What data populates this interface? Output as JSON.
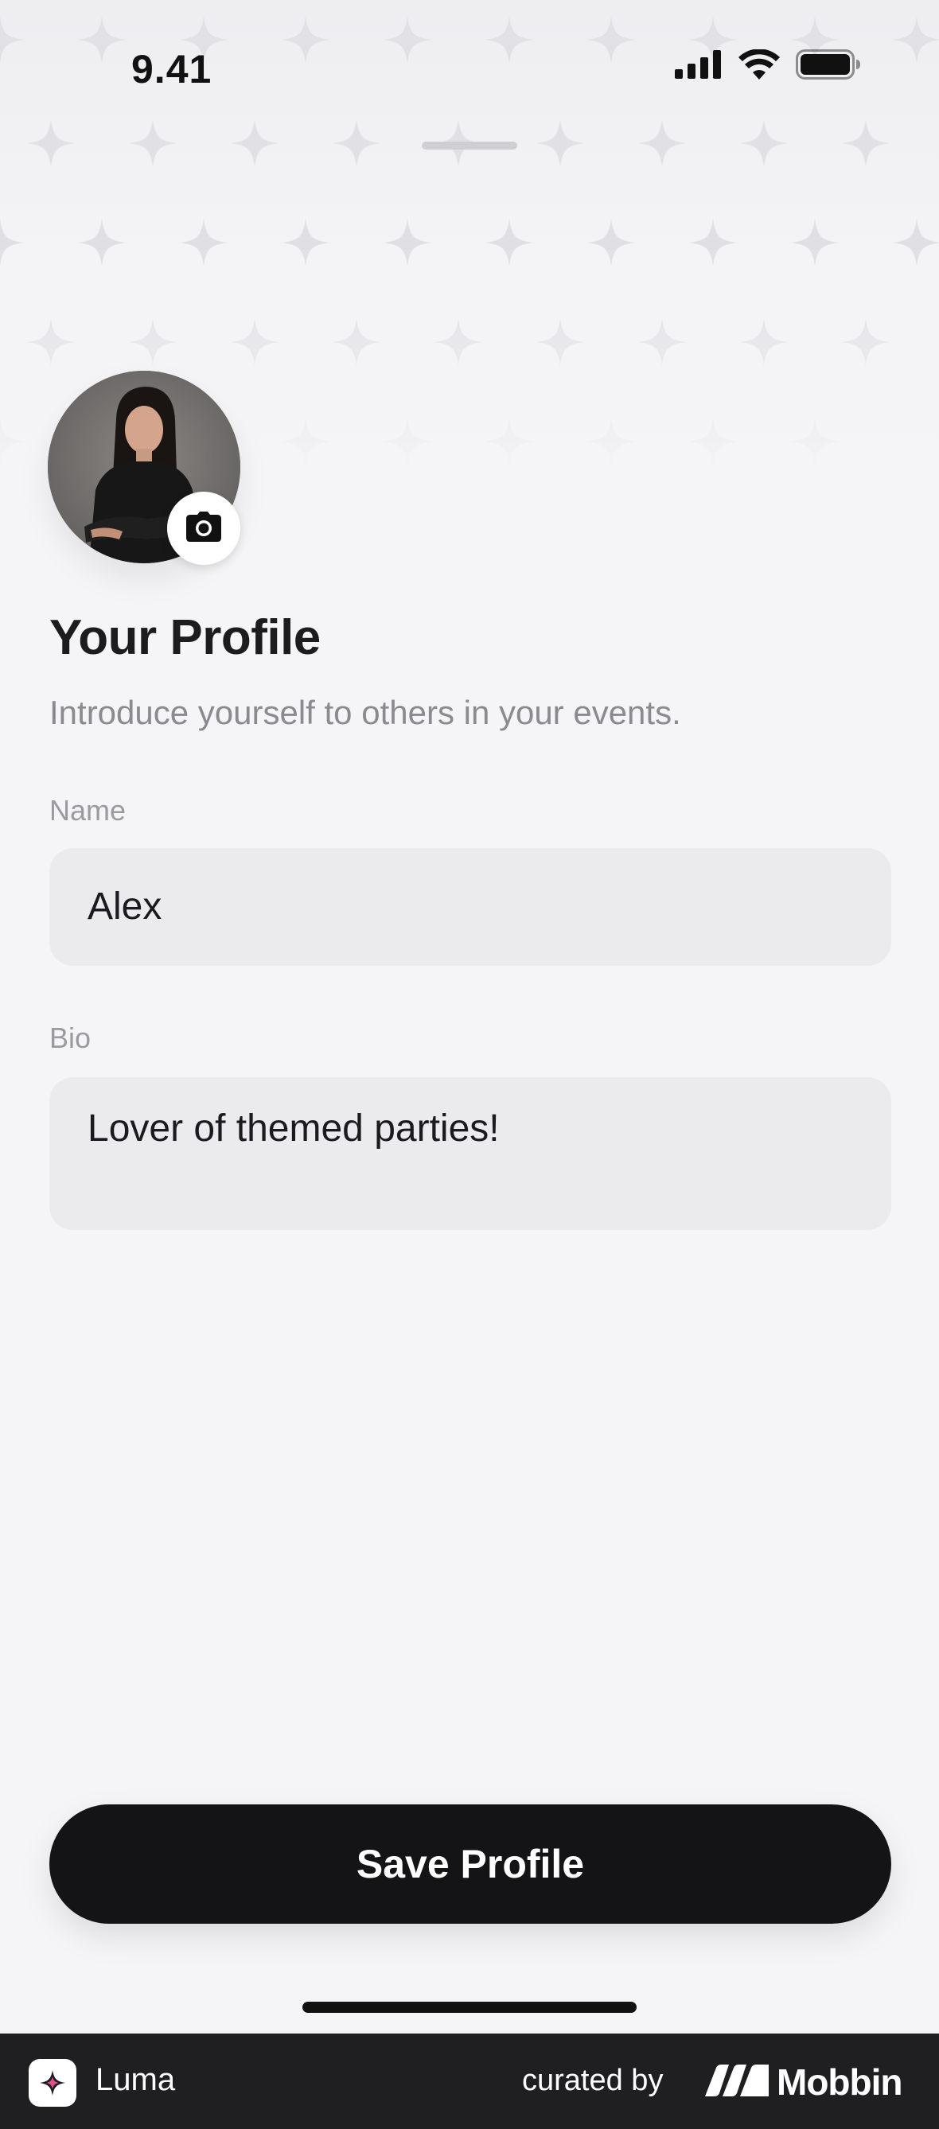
{
  "status_bar": {
    "time": "9.41"
  },
  "profile": {
    "title": "Your Profile",
    "subtitle": "Introduce yourself to others in your events."
  },
  "name_field": {
    "label": "Name",
    "value": "Alex"
  },
  "bio_field": {
    "label": "Bio",
    "value": "Lover of themed parties!"
  },
  "save_button": {
    "label": "Save Profile"
  },
  "footer": {
    "app_name": "Luma",
    "curated_by": "curated by",
    "brand": "Mobbin"
  },
  "colors": {
    "background": "#f5f5f7",
    "button": "#141416",
    "field": "#ebebee",
    "footer": "#1f1f21"
  },
  "icons": [
    "signal-icon",
    "wifi-icon",
    "battery-icon",
    "camera-icon",
    "luma-logo-icon",
    "mobbin-logo-icon"
  ]
}
